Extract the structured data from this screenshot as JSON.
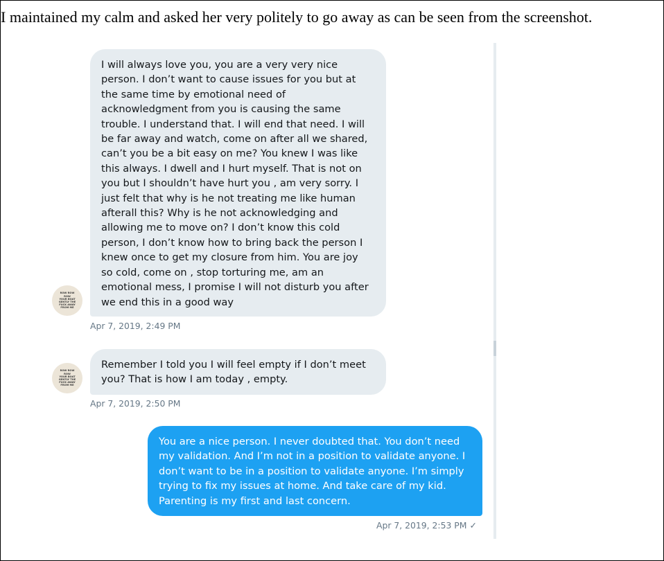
{
  "caption": "I maintained my calm and asked her very politely to go away as can be seen from the screenshot.",
  "conversation": {
    "messages": [
      {
        "direction": "received",
        "text": "I will always love you, you are a very very nice\nperson. I don’t want to cause issues for you but at\nthe same time by emotional need of\nacknowledgment from you is causing the same\ntrouble. I understand that. I will end that need. I will\nbe far away and watch, come on after all we shared,\ncan’t you be a bit easy on me? You knew I was like\nthis always. I dwell and I hurt myself. That is not on\nyou but I shouldn’t have hurt you , am very sorry. I\njust felt that why is he not treating me like human\nafterall this? Why is he not acknowledging and\nallowing me to move on? I don’t know this cold\nperson, I don’t know how to bring back the person I\nknew once to get my closure from him. You are joy\nso cold, come on , stop torturing me, am an\nemotional mess, I promise I will not disturb you after\nwe end this in a good way",
        "timestamp": "Apr 7, 2019, 2:49 PM",
        "avatar_text": "ROW ROW ROW\nYOUR BOAT\nGENTLY THE\nFUCK AWAY\nFROM ME"
      },
      {
        "direction": "received",
        "text": "Remember I told you I will feel empty if I don’t meet\nyou? That is how I am today , empty.",
        "timestamp": "Apr 7, 2019, 2:50 PM",
        "avatar_text": "ROW ROW ROW\nYOUR BOAT\nGENTLY THE\nFUCK AWAY\nFROM ME"
      },
      {
        "direction": "sent",
        "text": "You are a nice person. I never doubted that. You don’t need\nmy validation. And I’m not in a position to validate anyone. I\ndon’t want to be in a position to validate anyone. I’m simply\ntrying to fix my issues at home. And take care of my kid.\nParenting is my first and last concern.",
        "timestamp": "Apr 7, 2019, 2:53 PM",
        "read_mark": "✓"
      }
    ]
  },
  "colors": {
    "received_bubble": "#e6ecf0",
    "sent_bubble": "#1da1f2",
    "timestamp": "#657786"
  }
}
